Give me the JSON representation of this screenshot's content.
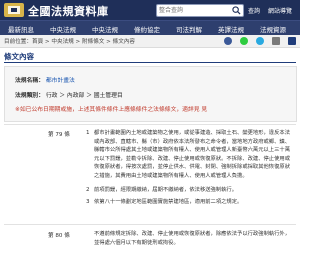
{
  "header": {
    "site_title": "全國法規資料庫",
    "search_placeholder": "整合查詢",
    "links": [
      "查詢",
      "網站導覽"
    ]
  },
  "nav": [
    "最新訊息",
    "中央法規",
    "中央法規",
    "條約協定",
    "司法判解",
    "英譯法規",
    "法規資源"
  ],
  "breadcrumb": "目前位置：首頁 > 中央法規 > 附條條文 > 條文內容",
  "page": {
    "section_title": "條文內容"
  },
  "info": {
    "law_name_label": "法規名稱：",
    "law_name_value": "都市計畫法",
    "law_category_label": "法規類別：",
    "law_category_value": "行政 ＞ 內政部 ＞ 國土管理目",
    "note": "※如已公布日期期或施，上述其條件條件上應條條件之法條條文，適詳見 見"
  },
  "articles": [
    {
      "number": "第 79 條",
      "paragraphs": [
        {
          "num": "1",
          "text": "都市計畫範圍內土地或建築物之使用，或從事建造、採取土石、變更地形，違反本法或內政部、直轄市、縣（市）政府依本法所發布之命令者，當地地方政府或鄉、鎮、縣轄市公所得處其土地或建築物所有權人、使用人或管理人新臺幣六萬元以上三十萬元以下罰鍰，並勒令拆除、改建、停止使用或恢復原狀。不拆除、改建、停止使用或恢復原狀者，得按次處罰，並停止供水、供電、封閉、強制拆除或採取其他恢復原狀之措施，其費用由土地或建築物所有權人、使用人或管理人負擔。"
        },
        {
          "num": "2",
          "text": "前項罰鍰，經限期繳納，屆期不繳納者，依法移送強制執行。"
        },
        {
          "num": "3",
          "text": "依第八十一條劃定地區範圍實施禁建地區，適用前二項之規定。"
        }
      ]
    },
    {
      "number": "第 80 條",
      "paragraphs": [
        {
          "num": "",
          "text": "不遵前條規定拆除、改建、停止使用或恢復原狀者，除應依法予以行政強制執行外，並得處六個月以下有期徒刑或拘役。"
        }
      ]
    }
  ],
  "colors": {
    "header_bg": "#1f2f59",
    "nav_bg": "#2e3f6e",
    "accent": "#1f3c7a",
    "link": "#1a56b0",
    "note": "#c0392b"
  },
  "icons": [
    "logo-icon",
    "search-icon",
    "facebook-icon",
    "line-icon",
    "twitter-icon",
    "print-icon",
    "font-size-icon"
  ]
}
